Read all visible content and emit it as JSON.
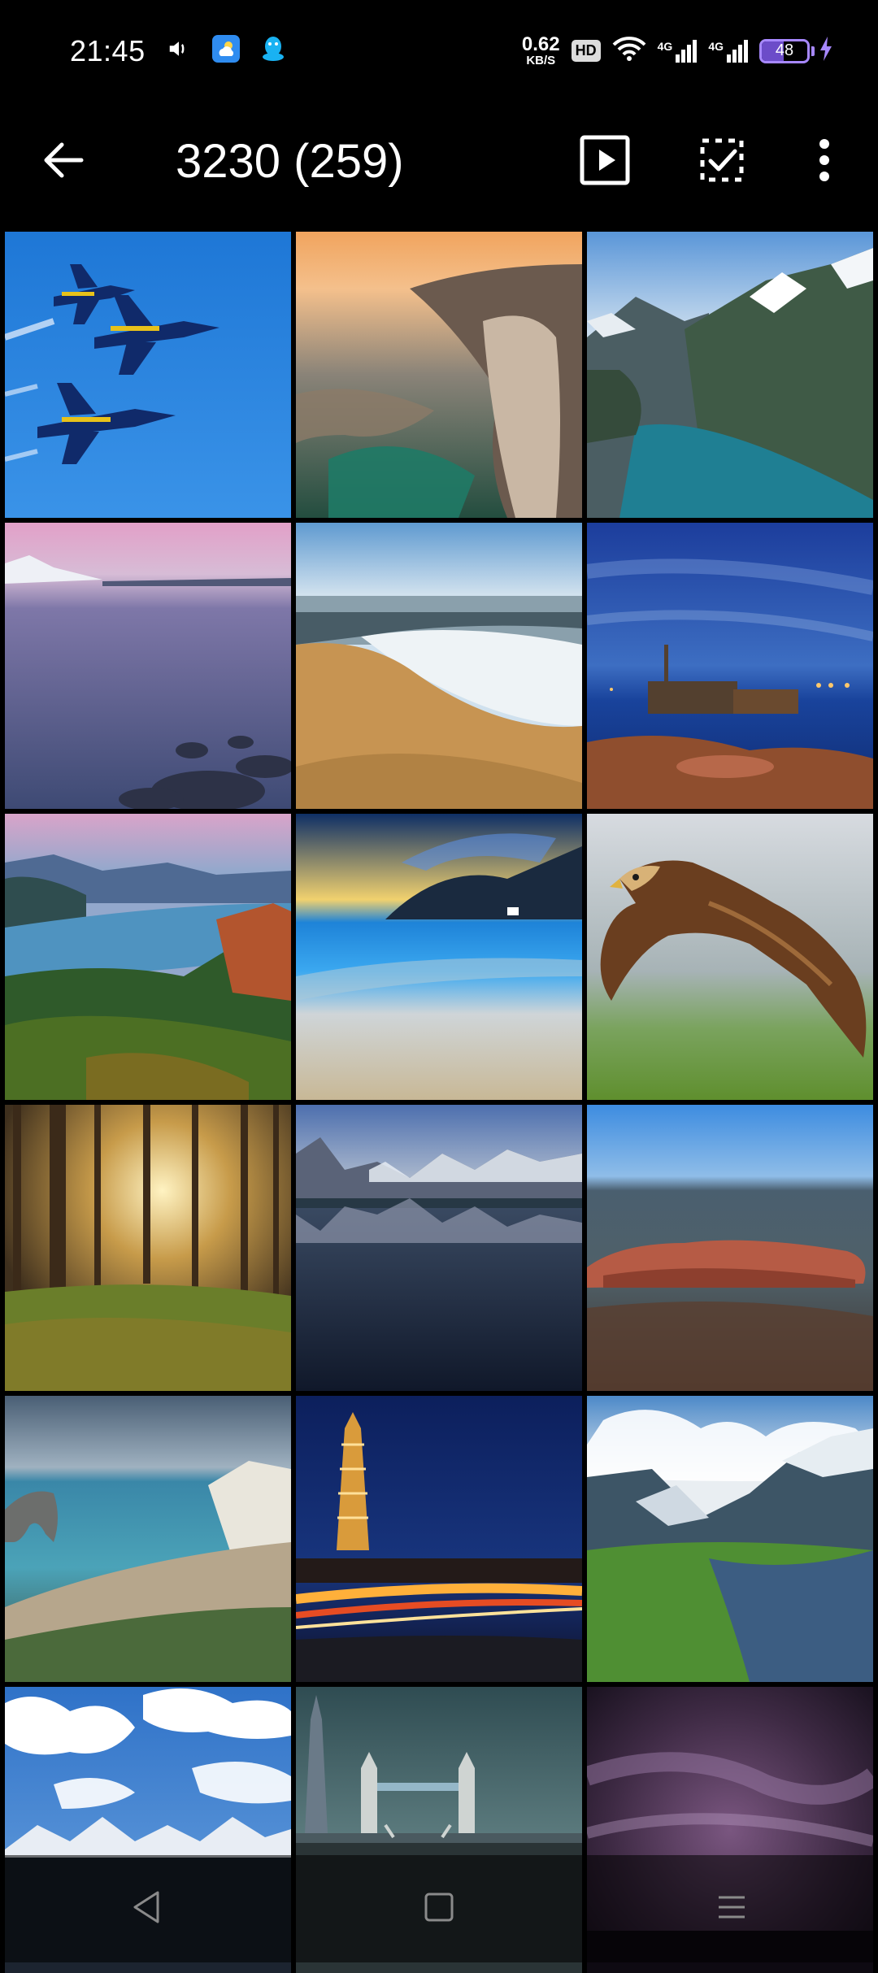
{
  "status": {
    "time": "21:45",
    "net_speed_value": "0.62",
    "net_speed_unit": "KB/S",
    "hd": "HD",
    "signal1_label": "4G",
    "signal2_label": "4G",
    "battery_level": 48,
    "battery_text": "48",
    "icons": [
      "volume-icon",
      "weather-app-icon",
      "qq-app-icon",
      "wifi-icon",
      "charging-icon"
    ]
  },
  "toolbar": {
    "title": "3230 (259)",
    "back_icon": "arrow-left-icon",
    "slideshow_icon": "play-icon",
    "select_icon": "checkbox-icon",
    "more_icon": "more-vertical-icon"
  },
  "grid": {
    "photos": [
      {
        "name": "photo-jets"
      },
      {
        "name": "photo-sunset-cliff"
      },
      {
        "name": "photo-fjord"
      },
      {
        "name": "photo-pink-lake"
      },
      {
        "name": "photo-beach-waves"
      },
      {
        "name": "photo-shipwreck-night"
      },
      {
        "name": "photo-river-gorge"
      },
      {
        "name": "photo-blue-beach"
      },
      {
        "name": "photo-eagle"
      },
      {
        "name": "photo-forest-sunbeams"
      },
      {
        "name": "photo-mountain-lake"
      },
      {
        "name": "photo-uluru"
      },
      {
        "name": "photo-durdle-door"
      },
      {
        "name": "photo-tower-light-trails"
      },
      {
        "name": "photo-alpine-stream"
      },
      {
        "name": "photo-mountain-clouds"
      },
      {
        "name": "photo-tower-bridge"
      },
      {
        "name": "photo-purple-storm"
      }
    ]
  },
  "nav": {
    "back_icon": "nav-back-icon",
    "home_icon": "nav-home-icon",
    "recents_icon": "nav-recents-icon"
  }
}
